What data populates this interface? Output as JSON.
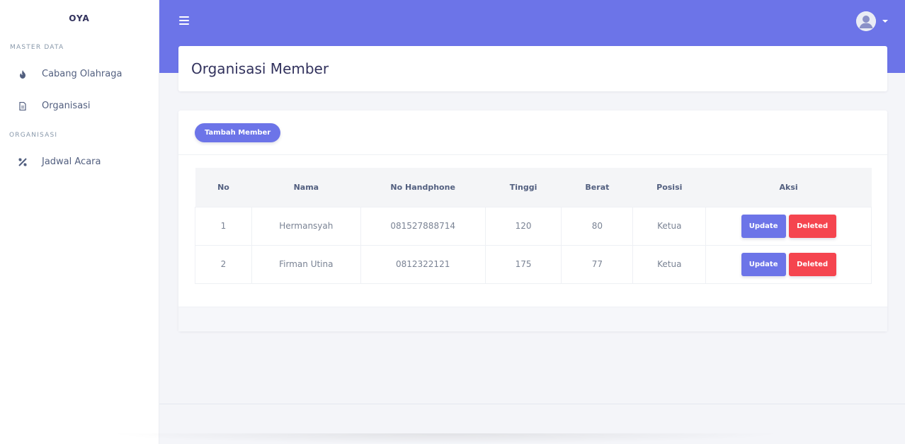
{
  "sidebar": {
    "brand": "OYA",
    "sections": [
      {
        "heading": "MASTER DATA",
        "items": [
          {
            "label": "Cabang Olahraga",
            "icon": "fire-icon"
          },
          {
            "label": "Organisasi",
            "icon": "document-icon"
          }
        ]
      },
      {
        "heading": "ORGANISASI",
        "items": [
          {
            "label": "Jadwal Acara",
            "icon": "tools-icon"
          }
        ]
      }
    ]
  },
  "header": {
    "menu_icon": "hamburger-icon",
    "user_icon": "user-avatar-icon"
  },
  "page": {
    "title": "Organisasi Member",
    "add_button": "Tambah Member"
  },
  "table": {
    "columns": [
      "No",
      "Nama",
      "No Handphone",
      "Tinggi",
      "Berat",
      "Posisi",
      "Aksi"
    ],
    "rows": [
      {
        "no": "1",
        "nama": "Hermansyah",
        "hp": "081527888714",
        "tinggi": "120",
        "berat": "80",
        "posisi": "Ketua",
        "update": "Update",
        "delete": "Deleted"
      },
      {
        "no": "2",
        "nama": "Firman Utina",
        "hp": "0812322121",
        "tinggi": "175",
        "berat": "77",
        "posisi": "Ketua",
        "update": "Update",
        "delete": "Deleted"
      }
    ]
  },
  "colors": {
    "primary": "#6c74e8",
    "danger": "#f5454f",
    "background": "#f4f5f9"
  }
}
